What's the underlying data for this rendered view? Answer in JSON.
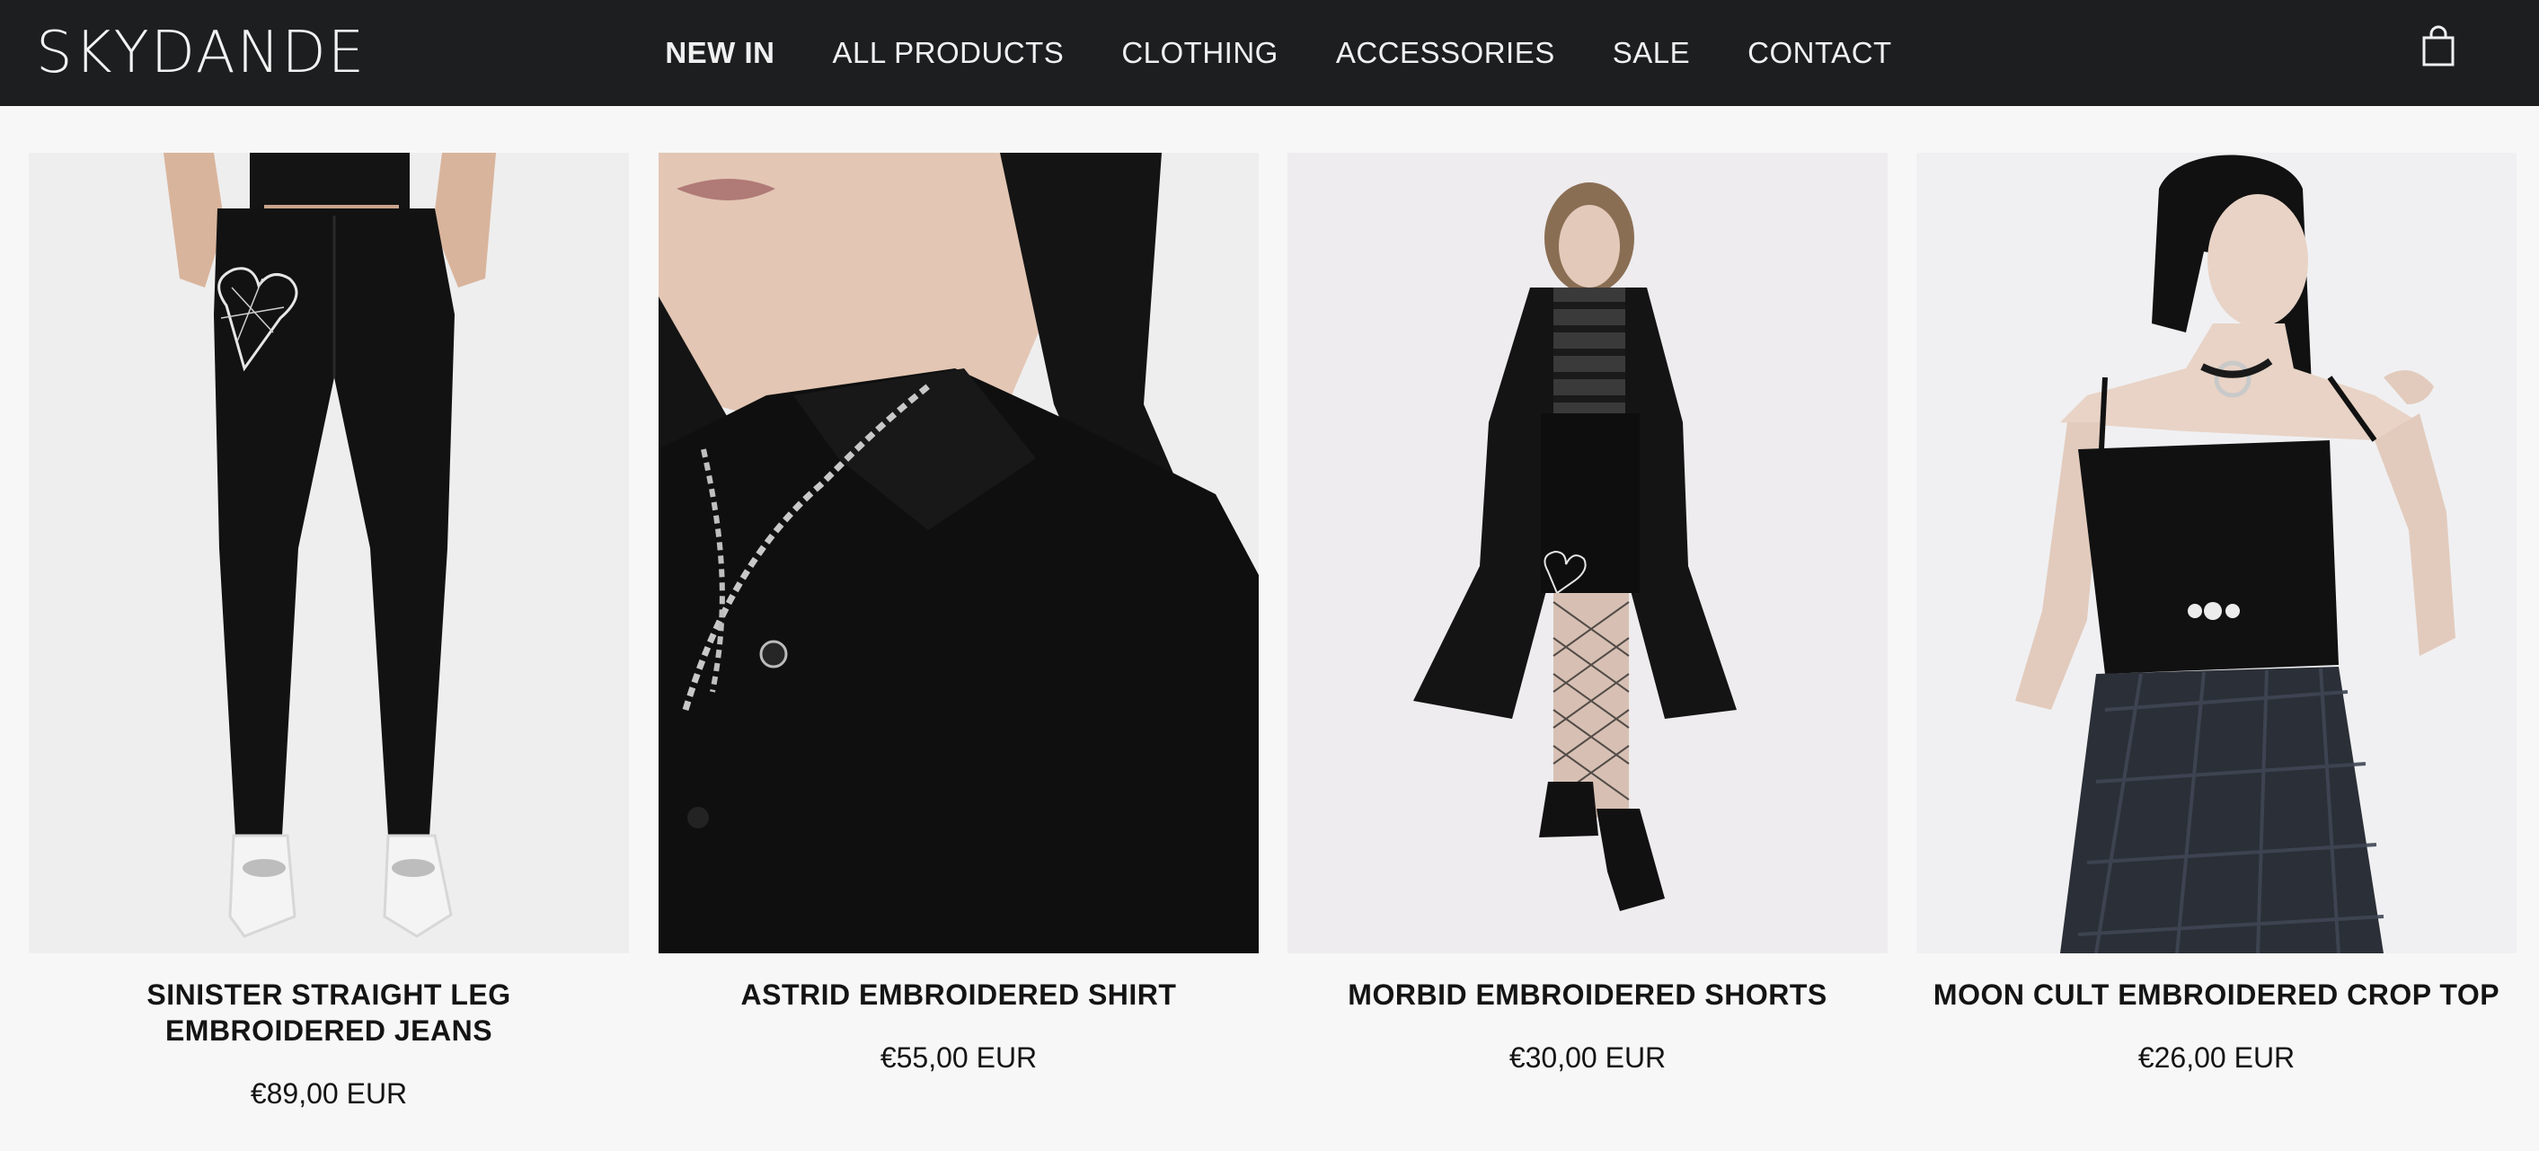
{
  "brand": {
    "logo_text": "SKYDANDE"
  },
  "nav": {
    "items": [
      {
        "label": "NEW IN",
        "active": true
      },
      {
        "label": "ALL PRODUCTS",
        "active": false
      },
      {
        "label": "CLOTHING",
        "active": false
      },
      {
        "label": "ACCESSORIES",
        "active": false
      },
      {
        "label": "SALE",
        "active": false
      },
      {
        "label": "CONTACT",
        "active": false
      }
    ],
    "cart_icon": "shopping-bag-icon"
  },
  "products": [
    {
      "title": "SINISTER STRAIGHT LEG EMBROIDERED JEANS",
      "price": "€89,00 EUR"
    },
    {
      "title": "ASTRID EMBROIDERED SHIRT",
      "price": "€55,00 EUR"
    },
    {
      "title": "MORBID EMBROIDERED SHORTS",
      "price": "€30,00 EUR"
    },
    {
      "title": "MOON CULT EMBROIDERED CROP TOP",
      "price": "€26,00 EUR"
    }
  ],
  "colors": {
    "header_bg": "#1d1e20",
    "header_text": "#f0f0f0",
    "page_bg": "#f7f7f7",
    "text": "#141414"
  }
}
